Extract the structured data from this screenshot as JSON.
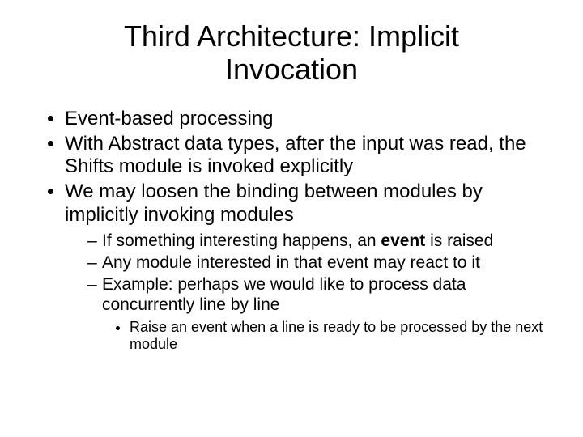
{
  "title": "Third Architecture: Implicit Invocation",
  "bullets": {
    "b1": "Event-based processing",
    "b2": "With Abstract data types, after the input was read, the Shifts module is invoked explicitly",
    "b3": "We may loosen the binding between modules by implicitly invoking modules",
    "s1a": "If something interesting happens, an ",
    "s1b": "event",
    "s1c": " is raised",
    "s2": "Any module interested in that event may react to it",
    "s3": "Example: perhaps we would like to process data concurrently line by line",
    "t1": "Raise an event when a line is ready to be processed by the next module"
  }
}
